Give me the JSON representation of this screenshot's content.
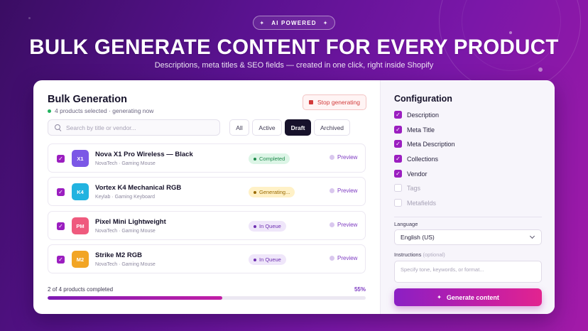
{
  "hero": {
    "badge_icon_left": "✦",
    "badge": "AI POWERED",
    "badge_icon_right": "✦",
    "title": "BULK GENERATE CONTENT FOR EVERY PRODUCT",
    "subtitle": "Descriptions, meta titles & SEO fields — created in one click, right inside Shopify"
  },
  "bulk": {
    "title": "Bulk Generation",
    "status": "4 products selected · generating now",
    "stop_label": "Stop generating",
    "search_placeholder": "Search by title or vendor...",
    "filters": [
      {
        "label": "All",
        "active": false
      },
      {
        "label": "Active",
        "active": false
      },
      {
        "label": "Draft",
        "active": true
      },
      {
        "label": "Archived",
        "active": false
      }
    ],
    "products": [
      {
        "initials": "X1",
        "color": "#7b57e6",
        "name": "Nova X1 Pro Wireless — Black",
        "meta": "NovaTech · Gaming Mouse",
        "status": "Completed",
        "status_kind": "completed",
        "preview": "Preview"
      },
      {
        "initials": "K4",
        "color": "#22b3e0",
        "name": "Vortex K4 Mechanical RGB",
        "meta": "Keylab · Gaming Keyboard",
        "status": "Generating...",
        "status_kind": "generating",
        "preview": "Preview"
      },
      {
        "initials": "PM",
        "color": "#ef5a7e",
        "name": "Pixel Mini Lightweight",
        "meta": "NovaTech · Gaming Mouse",
        "status": "In Queue",
        "status_kind": "queue",
        "preview": "Preview"
      },
      {
        "initials": "M2",
        "color": "#f2a524",
        "name": "Strike M2 RGB",
        "meta": "NovaTech · Gaming Mouse",
        "status": "In Queue",
        "status_kind": "queue",
        "preview": "Preview"
      }
    ],
    "progress_label": "2 of 4 products completed",
    "progress_pct": "55%",
    "progress_value": 0.55
  },
  "config": {
    "title": "Configuration",
    "options": [
      {
        "label": "Description",
        "checked": true
      },
      {
        "label": "Meta Title",
        "checked": true
      },
      {
        "label": "Meta Description",
        "checked": true
      },
      {
        "label": "Collections",
        "checked": true
      },
      {
        "label": "Vendor",
        "checked": true
      },
      {
        "label": "Tags",
        "checked": false
      },
      {
        "label": "Metafields",
        "checked": false
      }
    ],
    "language_label": "Language",
    "language_value": "English (US)",
    "instructions_label": "Instructions",
    "instructions_optional": "(optional)",
    "instructions_placeholder": "Specify tone, keywords, or format...",
    "generate_icon": "✦",
    "generate_label": "Generate content"
  },
  "colors": {
    "accent": "#9b1ec0",
    "completed_bg": "#dcf5e6",
    "completed_fg": "#1f8a4c",
    "generating_bg": "#fff1c7",
    "generating_fg": "#9a6a00",
    "queue_bg": "#efe6fa",
    "queue_fg": "#6d2fb0"
  }
}
